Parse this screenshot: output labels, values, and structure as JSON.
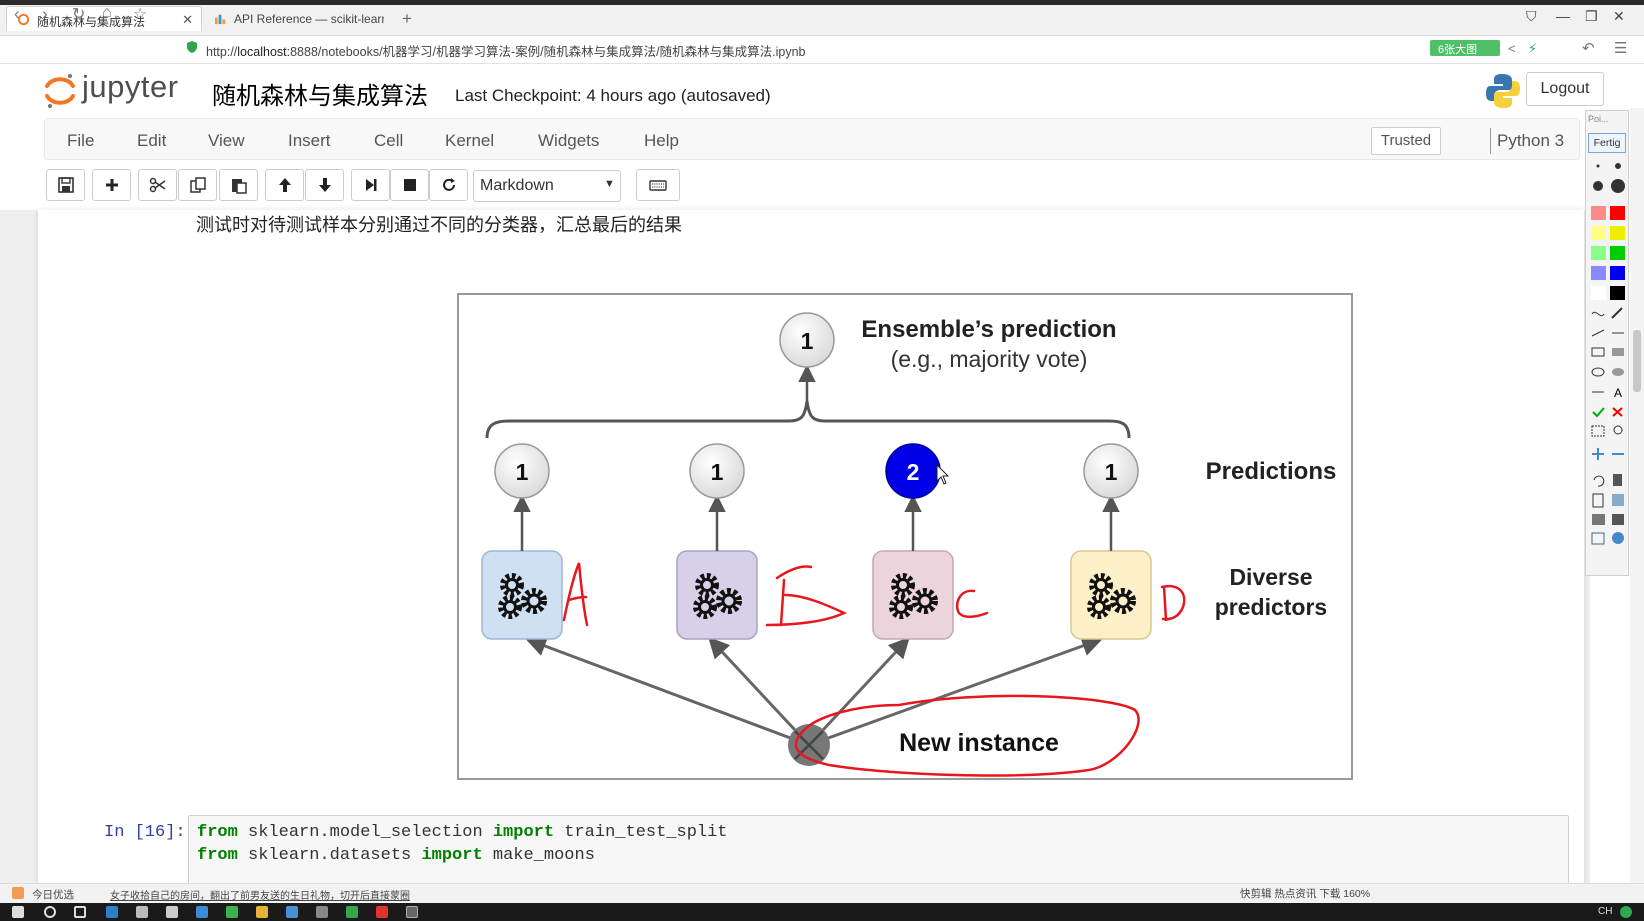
{
  "browser": {
    "tabs": [
      {
        "title": "随机森林与集成算法",
        "active": true
      },
      {
        "title": "API Reference — scikit-learn",
        "active": false
      }
    ],
    "new_tab_label": "+",
    "url_prefix": "http://",
    "url_host": "localhost",
    "url_rest": ":8888/notebooks/机器学习/机器学习算法-案例/随机森林与集成算法/随机森林与集成算法.ipynb",
    "badge_text": "6张大图"
  },
  "jupyter": {
    "logo_text": "jupyter",
    "notebook_title": "随机森林与集成算法",
    "checkpoint": "Last Checkpoint: 4 hours ago (autosaved)",
    "logout_label": "Logout",
    "menu": [
      "File",
      "Edit",
      "View",
      "Insert",
      "Cell",
      "Kernel",
      "Widgets",
      "Help"
    ],
    "trusted_label": "Trusted",
    "kernel_name": "Python 3",
    "cell_type": "Markdown"
  },
  "notebook": {
    "markdown_text": "测试时对待测试样本分别通过不同的分类器，汇总最后的结果",
    "figure": {
      "top_node": "1",
      "ensemble_title": "Ensemble’s prediction",
      "ensemble_subtitle": "(e.g., majority vote)",
      "predictions_label": "Predictions",
      "predictions": [
        "1",
        "1",
        "2",
        "1"
      ],
      "predictors_label_1": "Diverse",
      "predictors_label_2": "predictors",
      "new_instance_label": "New instance",
      "handwritten_labels": [
        "A",
        "B",
        "C",
        "D"
      ],
      "colors": {
        "predictor_a": "#cfe0f3",
        "predictor_b": "#d7d0e8",
        "predictor_c": "#ecd4dd",
        "predictor_d": "#fbf0c8",
        "highlight_node": "#0000e6",
        "ink": "#e8161e"
      }
    },
    "code_cell": {
      "prompt": "In [16]:",
      "lines": [
        {
          "kw1": "from",
          "mod": " sklearn.model_selection ",
          "kw2": "import",
          "name": " train_test_split"
        },
        {
          "kw1": "from",
          "mod": " sklearn.datasets ",
          "kw2": "import",
          "name": " make_moons"
        }
      ]
    }
  },
  "palette": {
    "header": "Poi...",
    "done_label": "Fertig"
  },
  "statusbar": {
    "left": "今日优选",
    "news": "女子收拾自己的房间，翻出了前男友送的生日礼物，切开后直接蒙圈",
    "right": "快剪辑   热点资讯        下载          160%"
  },
  "taskbar": {
    "lang": "CH"
  }
}
